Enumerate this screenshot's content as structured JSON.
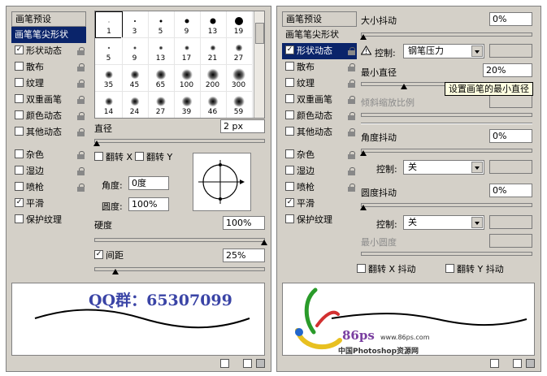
{
  "left_panel": {
    "sidebar": {
      "header": "画笔预设",
      "items": [
        {
          "label": "画笔笔尖形状",
          "check": false,
          "selected": true
        },
        {
          "label": "形状动态",
          "check": true
        },
        {
          "label": "散布",
          "check": false
        },
        {
          "label": "纹理",
          "check": false
        },
        {
          "label": "双重画笔",
          "check": false
        },
        {
          "label": "颜色动态",
          "check": false
        },
        {
          "label": "其他动态",
          "check": false
        },
        {
          "label": "杂色",
          "check": false
        },
        {
          "label": "湿边",
          "check": false
        },
        {
          "label": "喷枪",
          "check": false
        },
        {
          "label": "平滑",
          "check": true
        },
        {
          "label": "保护纹理",
          "check": false
        }
      ]
    },
    "tips": [
      "1",
      "3",
      "5",
      "9",
      "13",
      "19",
      "5",
      "9",
      "13",
      "17",
      "21",
      "27",
      "35",
      "45",
      "65",
      "100",
      "200",
      "300",
      "14",
      "24",
      "27",
      "39",
      "46",
      "59"
    ],
    "diameter_label": "直径",
    "diameter_value": "2 px",
    "flip_x": "翻转 X",
    "flip_y": "翻转 Y",
    "angle_label": "角度:",
    "angle_value": "0度",
    "roundness_label": "圆度:",
    "roundness_value": "100%",
    "hardness_label": "硬度",
    "hardness_value": "100%",
    "spacing_label": "间距",
    "spacing_value": "25%",
    "preview_text": "QQ群：65307099"
  },
  "right_panel": {
    "sidebar": {
      "header": "画笔预设",
      "items": [
        {
          "label": "画笔笔尖形状",
          "check": false,
          "tip": true
        },
        {
          "label": "形状动态",
          "check": true,
          "selected": true
        },
        {
          "label": "散布",
          "check": false
        },
        {
          "label": "纹理",
          "check": false
        },
        {
          "label": "双重画笔",
          "check": false
        },
        {
          "label": "颜色动态",
          "check": false
        },
        {
          "label": "其他动态",
          "check": false
        },
        {
          "label": "杂色",
          "check": false
        },
        {
          "label": "湿边",
          "check": false
        },
        {
          "label": "喷枪",
          "check": false
        },
        {
          "label": "平滑",
          "check": true
        },
        {
          "label": "保护纹理",
          "check": false
        }
      ]
    },
    "size_jitter_label": "大小抖动",
    "size_jitter_value": "0%",
    "control_label": "控制:",
    "size_control": "钢笔压力",
    "min_diameter_label": "最小直径",
    "min_diameter_value": "20%",
    "tooltip": "设置画笔的最小直径",
    "tilt_scale_label": "倾斜缩放比例",
    "angle_jitter_label": "角度抖动",
    "angle_jitter_value": "0%",
    "angle_control": "关",
    "roundness_jitter_label": "圆度抖动",
    "roundness_jitter_value": "0%",
    "roundness_control": "关",
    "min_roundness_label": "最小圆度",
    "flip_x_jitter": "翻转 X 抖动",
    "flip_y_jitter": "翻转 Y 抖动",
    "logo_text": "86ps",
    "logo_url": "www.86ps.com",
    "logo_site": "中国Photoshop资源网"
  }
}
